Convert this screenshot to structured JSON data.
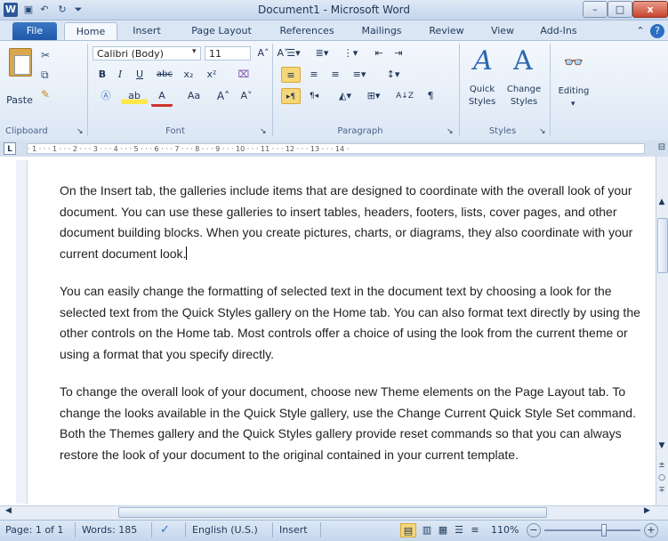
{
  "window": {
    "title": "Document1 - Microsoft Word",
    "minimize": "–",
    "maximize": "□",
    "close": "x"
  },
  "quick_access": {
    "word_logo": "W",
    "save": "💾",
    "undo": "↶",
    "redo": "↻",
    "customize": "⏷"
  },
  "tabs": [
    {
      "label": "File"
    },
    {
      "label": "Home"
    },
    {
      "label": "Insert"
    },
    {
      "label": "Page Layout"
    },
    {
      "label": "References"
    },
    {
      "label": "Mailings"
    },
    {
      "label": "Review"
    },
    {
      "label": "View"
    },
    {
      "label": "Add-Ins"
    }
  ],
  "ribbon": {
    "clipboard": {
      "paste": "Paste",
      "group": "Clipboard"
    },
    "font": {
      "font_name": "Calibri (Body)",
      "font_size": "11",
      "group": "Font",
      "bold": "B",
      "italic": "I",
      "underline": "U",
      "strike": "abc",
      "sub": "x₂",
      "sup": "x²",
      "grow": "A˄",
      "shrink": "A˅",
      "case": "Aa",
      "highlight": "ab",
      "font_color": "A"
    },
    "paragraph": {
      "group": "Paragraph",
      "sort": "A↓Z",
      "pilcrow": "¶"
    },
    "styles": {
      "quick": "Quick\nStyles",
      "quick1": "Quick",
      "quick2": "Styles",
      "change1": "Change",
      "change2": "Styles",
      "group": "Styles"
    },
    "editing": {
      "label": "Editing"
    }
  },
  "ruler": {
    "marks": "· 1 · · · 1 · · · 2 · · · 3 · · · 4 · · · 5 · · · 6 · · · 7 · · · 8 · · · 9 · · · 10 · · · 11 · · · 12 · · · 13 · · · 14 ·"
  },
  "document": {
    "paragraphs": [
      "On the Insert tab, the galleries include items that are designed to coordinate with the overall look of your document. You can use these galleries to insert tables, headers, footers, lists, cover pages, and other document building blocks. When you create pictures, charts, or diagrams, they also coordinate with your current document look.",
      "You can easily change the formatting of selected text in the document text by choosing a look for the selected text from the Quick Styles gallery on the Home tab. You can also format text directly by using the other controls on the Home tab. Most controls offer a choice of using the look from the current theme or using a format that you specify directly.",
      "To change the overall look of your document, choose new Theme elements on the Page Layout tab. To change the looks available in the Quick Style gallery, use the Change Current Quick Style Set command. Both the Themes gallery and the Quick Styles gallery provide reset commands so that you can always restore the look of your document to the original contained in your current template."
    ]
  },
  "status": {
    "page": "Page: 1 of 1",
    "words": "Words: 185",
    "language": "English (U.S.)",
    "mode": "Insert",
    "zoom": "110%",
    "zoom_minus": "−",
    "zoom_plus": "+"
  },
  "colors": {
    "accent": "#2b5797",
    "file_tab": "#1f58a8",
    "ribbon_bg": "#dce7f5"
  }
}
